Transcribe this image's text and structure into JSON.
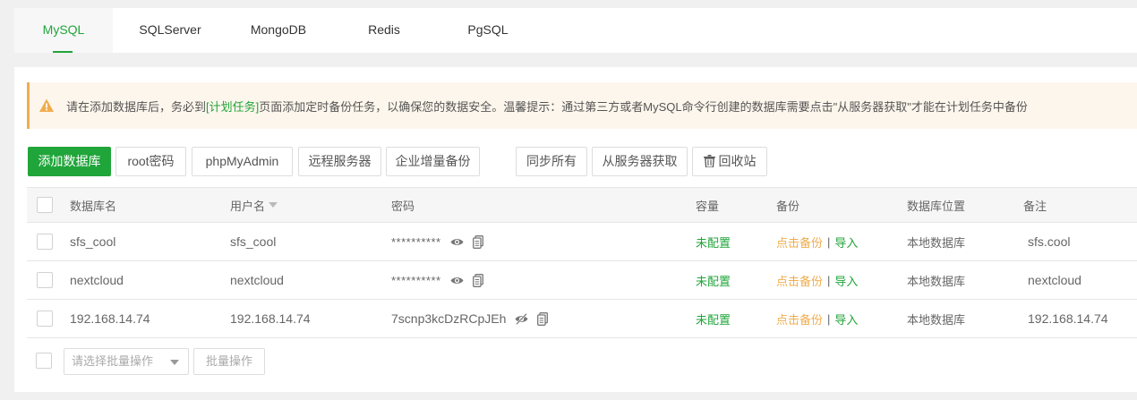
{
  "tabs": [
    {
      "label": "MySQL",
      "active": true
    },
    {
      "label": "SQLServer",
      "active": false
    },
    {
      "label": "MongoDB",
      "active": false
    },
    {
      "label": "Redis",
      "active": false
    },
    {
      "label": "PgSQL",
      "active": false
    }
  ],
  "alert": {
    "icon": "warning-icon",
    "text_before": "请在添加数据库后，务必到",
    "link": "[计划任务]",
    "text_after": "页面添加定时备份任务，以确保您的数据安全。温馨提示：通过第三方或者MySQL命令行创建的数据库需要点击\"从服务器获取\"才能在计划任务中备份"
  },
  "toolbar": {
    "add_database": "添加数据库",
    "root_password": "root密码",
    "phpmyadmin": "phpMyAdmin",
    "remote_server": "远程服务器",
    "enterprise_backup": "企业增量备份",
    "sync_all": "同步所有",
    "fetch_from_server": "从服务器获取",
    "recycle_bin": "回收站"
  },
  "table": {
    "headers": {
      "name": "数据库名",
      "username": "用户名",
      "password": "密码",
      "capacity": "容量",
      "backup": "备份",
      "location": "数据库位置",
      "note": "备注"
    },
    "rows": [
      {
        "name": "sfs_cool",
        "username": "sfs_cool",
        "password": "**********",
        "capacity": "未配置",
        "backup": "点击备份",
        "separator": "|",
        "import": "导入",
        "location": "本地数据库",
        "note": "sfs.cool"
      },
      {
        "name": "nextcloud",
        "username": "nextcloud",
        "password": "**********",
        "capacity": "未配置",
        "backup": "点击备份",
        "separator": "|",
        "import": "导入",
        "location": "本地数据库",
        "note": "nextcloud"
      },
      {
        "name": "192.168.14.74",
        "username": "192.168.14.74",
        "password": "7scnp3kcDzRCpJEh",
        "capacity": "未配置",
        "backup": "点击备份",
        "separator": "|",
        "import": "导入",
        "location": "本地数据库",
        "note": "192.168.14.74"
      }
    ]
  },
  "batch": {
    "select_placeholder": "请选择批量操作",
    "button": "批量操作"
  },
  "colors": {
    "accent": "#20a53a",
    "warning": "#f0ad4e"
  }
}
